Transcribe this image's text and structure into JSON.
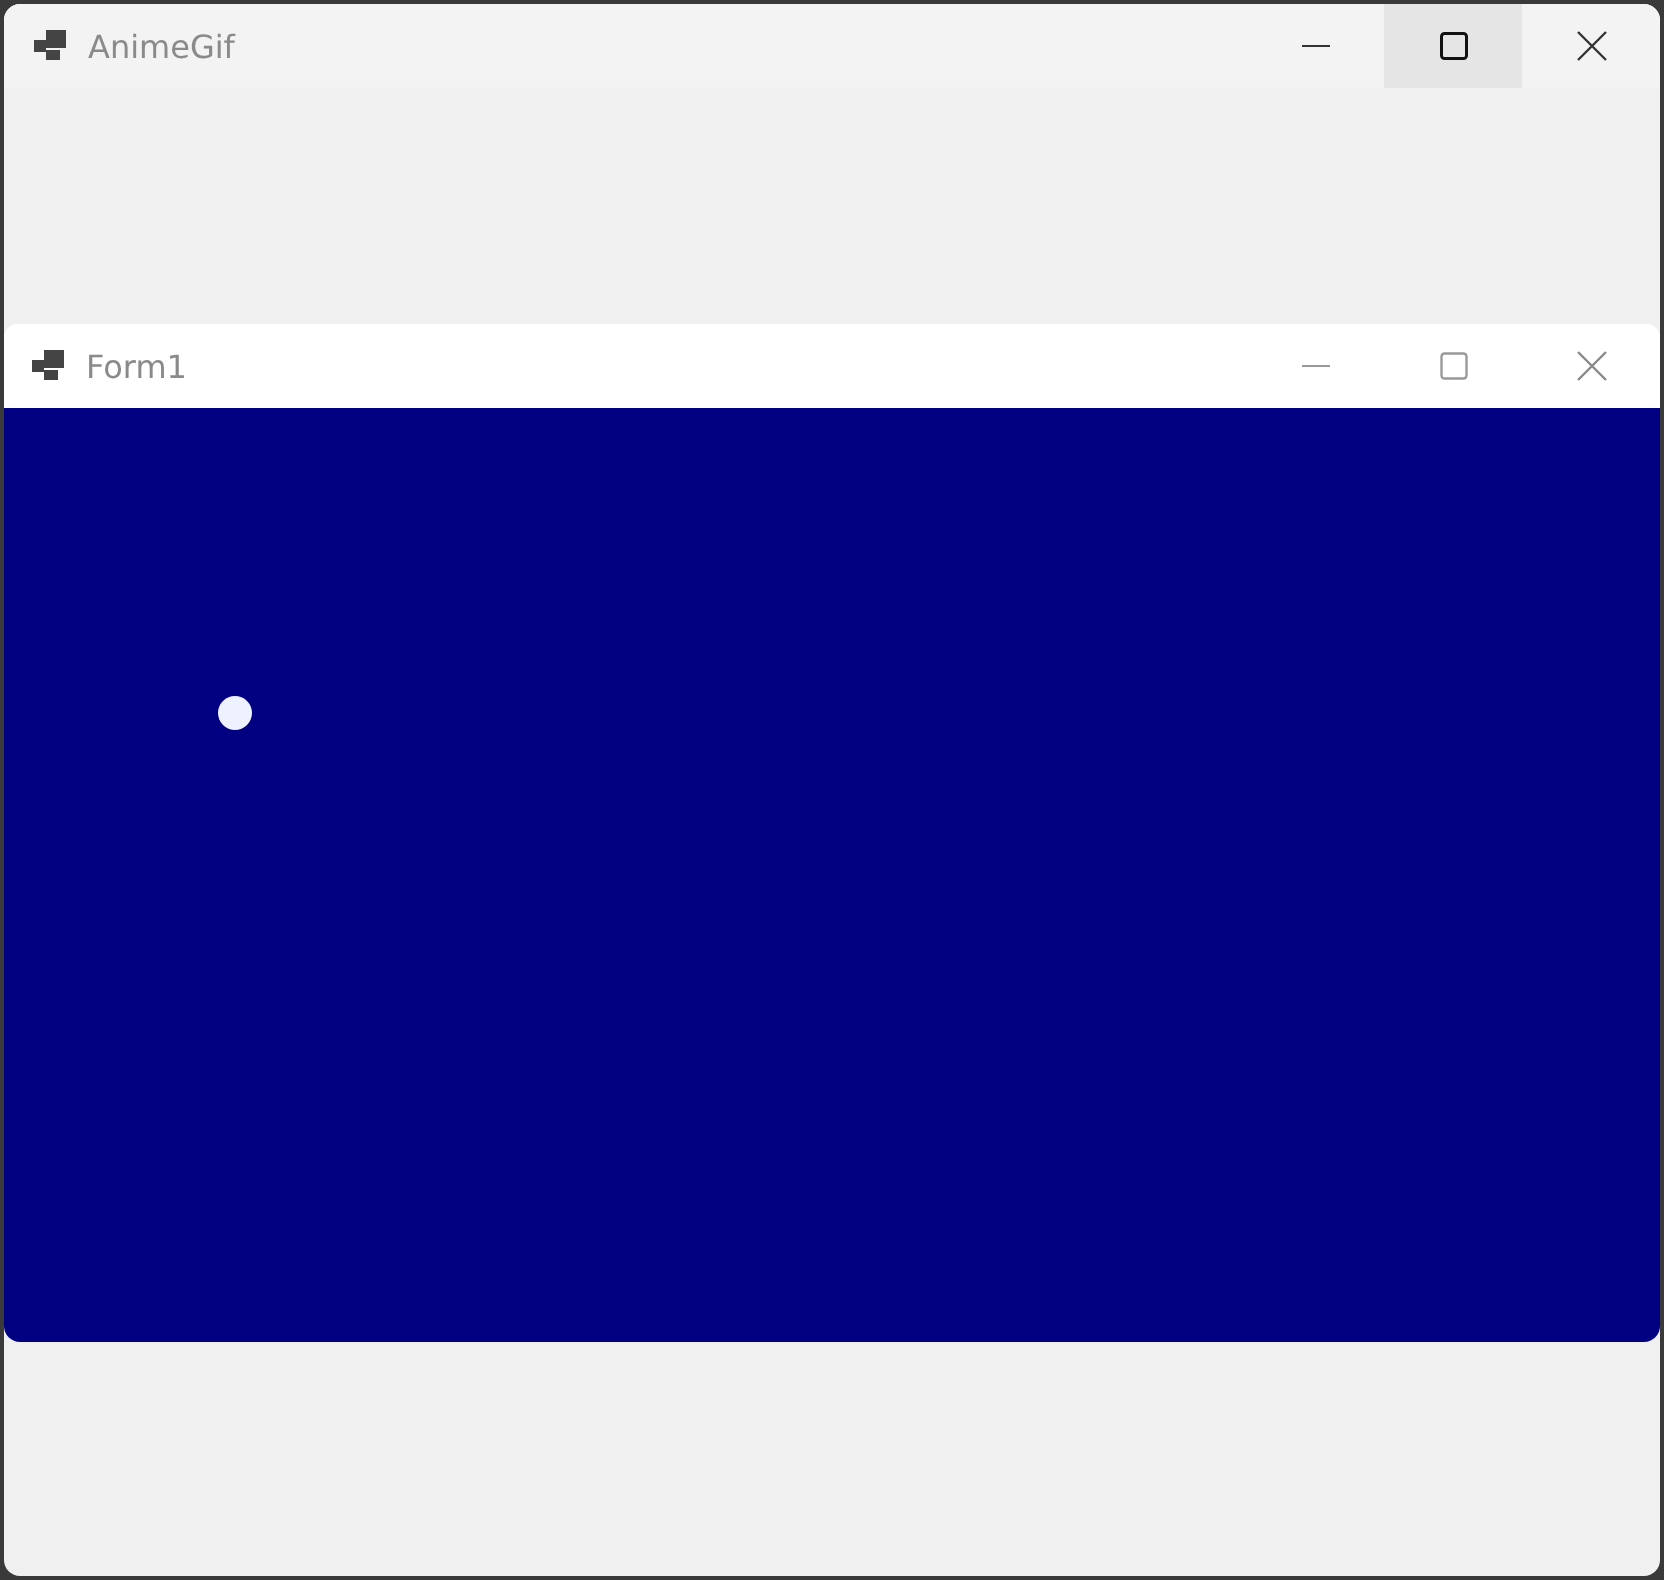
{
  "main_window": {
    "title": "AnimeGif",
    "maximize_hovered": true
  },
  "child_window": {
    "title": "Form1",
    "maximize_hovered": false
  }
}
